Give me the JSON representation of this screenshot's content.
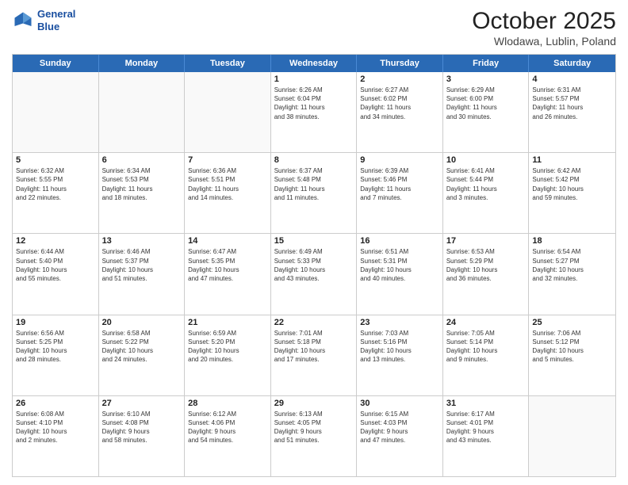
{
  "header": {
    "logo_line1": "General",
    "logo_line2": "Blue",
    "month": "October 2025",
    "location": "Wlodawa, Lublin, Poland"
  },
  "day_headers": [
    "Sunday",
    "Monday",
    "Tuesday",
    "Wednesday",
    "Thursday",
    "Friday",
    "Saturday"
  ],
  "weeks": [
    [
      {
        "num": "",
        "info": ""
      },
      {
        "num": "",
        "info": ""
      },
      {
        "num": "",
        "info": ""
      },
      {
        "num": "1",
        "info": "Sunrise: 6:26 AM\nSunset: 6:04 PM\nDaylight: 11 hours\nand 38 minutes."
      },
      {
        "num": "2",
        "info": "Sunrise: 6:27 AM\nSunset: 6:02 PM\nDaylight: 11 hours\nand 34 minutes."
      },
      {
        "num": "3",
        "info": "Sunrise: 6:29 AM\nSunset: 6:00 PM\nDaylight: 11 hours\nand 30 minutes."
      },
      {
        "num": "4",
        "info": "Sunrise: 6:31 AM\nSunset: 5:57 PM\nDaylight: 11 hours\nand 26 minutes."
      }
    ],
    [
      {
        "num": "5",
        "info": "Sunrise: 6:32 AM\nSunset: 5:55 PM\nDaylight: 11 hours\nand 22 minutes."
      },
      {
        "num": "6",
        "info": "Sunrise: 6:34 AM\nSunset: 5:53 PM\nDaylight: 11 hours\nand 18 minutes."
      },
      {
        "num": "7",
        "info": "Sunrise: 6:36 AM\nSunset: 5:51 PM\nDaylight: 11 hours\nand 14 minutes."
      },
      {
        "num": "8",
        "info": "Sunrise: 6:37 AM\nSunset: 5:48 PM\nDaylight: 11 hours\nand 11 minutes."
      },
      {
        "num": "9",
        "info": "Sunrise: 6:39 AM\nSunset: 5:46 PM\nDaylight: 11 hours\nand 7 minutes."
      },
      {
        "num": "10",
        "info": "Sunrise: 6:41 AM\nSunset: 5:44 PM\nDaylight: 11 hours\nand 3 minutes."
      },
      {
        "num": "11",
        "info": "Sunrise: 6:42 AM\nSunset: 5:42 PM\nDaylight: 10 hours\nand 59 minutes."
      }
    ],
    [
      {
        "num": "12",
        "info": "Sunrise: 6:44 AM\nSunset: 5:40 PM\nDaylight: 10 hours\nand 55 minutes."
      },
      {
        "num": "13",
        "info": "Sunrise: 6:46 AM\nSunset: 5:37 PM\nDaylight: 10 hours\nand 51 minutes."
      },
      {
        "num": "14",
        "info": "Sunrise: 6:47 AM\nSunset: 5:35 PM\nDaylight: 10 hours\nand 47 minutes."
      },
      {
        "num": "15",
        "info": "Sunrise: 6:49 AM\nSunset: 5:33 PM\nDaylight: 10 hours\nand 43 minutes."
      },
      {
        "num": "16",
        "info": "Sunrise: 6:51 AM\nSunset: 5:31 PM\nDaylight: 10 hours\nand 40 minutes."
      },
      {
        "num": "17",
        "info": "Sunrise: 6:53 AM\nSunset: 5:29 PM\nDaylight: 10 hours\nand 36 minutes."
      },
      {
        "num": "18",
        "info": "Sunrise: 6:54 AM\nSunset: 5:27 PM\nDaylight: 10 hours\nand 32 minutes."
      }
    ],
    [
      {
        "num": "19",
        "info": "Sunrise: 6:56 AM\nSunset: 5:25 PM\nDaylight: 10 hours\nand 28 minutes."
      },
      {
        "num": "20",
        "info": "Sunrise: 6:58 AM\nSunset: 5:22 PM\nDaylight: 10 hours\nand 24 minutes."
      },
      {
        "num": "21",
        "info": "Sunrise: 6:59 AM\nSunset: 5:20 PM\nDaylight: 10 hours\nand 20 minutes."
      },
      {
        "num": "22",
        "info": "Sunrise: 7:01 AM\nSunset: 5:18 PM\nDaylight: 10 hours\nand 17 minutes."
      },
      {
        "num": "23",
        "info": "Sunrise: 7:03 AM\nSunset: 5:16 PM\nDaylight: 10 hours\nand 13 minutes."
      },
      {
        "num": "24",
        "info": "Sunrise: 7:05 AM\nSunset: 5:14 PM\nDaylight: 10 hours\nand 9 minutes."
      },
      {
        "num": "25",
        "info": "Sunrise: 7:06 AM\nSunset: 5:12 PM\nDaylight: 10 hours\nand 5 minutes."
      }
    ],
    [
      {
        "num": "26",
        "info": "Sunrise: 6:08 AM\nSunset: 4:10 PM\nDaylight: 10 hours\nand 2 minutes."
      },
      {
        "num": "27",
        "info": "Sunrise: 6:10 AM\nSunset: 4:08 PM\nDaylight: 9 hours\nand 58 minutes."
      },
      {
        "num": "28",
        "info": "Sunrise: 6:12 AM\nSunset: 4:06 PM\nDaylight: 9 hours\nand 54 minutes."
      },
      {
        "num": "29",
        "info": "Sunrise: 6:13 AM\nSunset: 4:05 PM\nDaylight: 9 hours\nand 51 minutes."
      },
      {
        "num": "30",
        "info": "Sunrise: 6:15 AM\nSunset: 4:03 PM\nDaylight: 9 hours\nand 47 minutes."
      },
      {
        "num": "31",
        "info": "Sunrise: 6:17 AM\nSunset: 4:01 PM\nDaylight: 9 hours\nand 43 minutes."
      },
      {
        "num": "",
        "info": ""
      }
    ]
  ]
}
